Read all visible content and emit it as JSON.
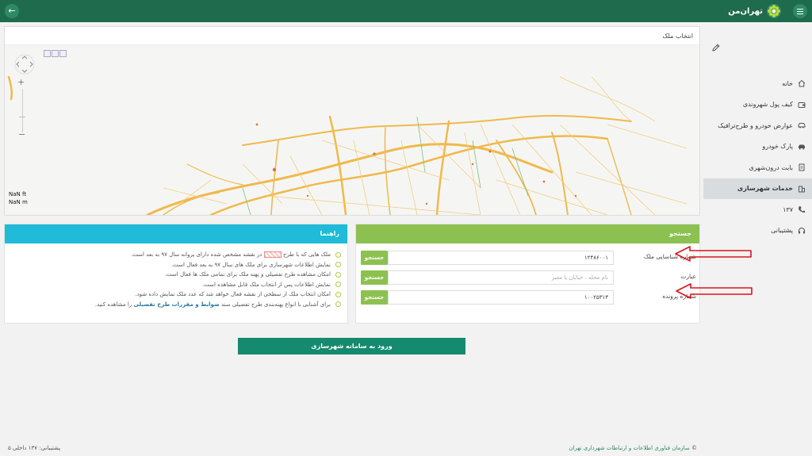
{
  "header": {
    "brand": "تهران‌من"
  },
  "sidebar": {
    "items": [
      {
        "label": "خانه",
        "icon": "home-icon"
      },
      {
        "label": "کیف پول شهروندی",
        "icon": "wallet-icon"
      },
      {
        "label": "عوارض خودرو و طرح‌ترافیک",
        "icon": "car-icon"
      },
      {
        "label": "پارک خودرو",
        "icon": "parking-icon"
      },
      {
        "label": "بابت درون‌شهری",
        "icon": "receipt-icon"
      },
      {
        "label": "خدمات شهرسازی",
        "icon": "building-icon",
        "active": true
      },
      {
        "label": "۱۳۷",
        "icon": "phone-icon"
      },
      {
        "label": "پشتیبانی",
        "icon": "headset-icon"
      }
    ]
  },
  "map": {
    "title": "انتخاب ملک",
    "scale_ft": "NaN ft",
    "scale_m": "NaN m"
  },
  "guide": {
    "title": "راهنما",
    "items": [
      {
        "pre": "ملک هایی که با طرح",
        "post": "در نقشه مشخص شده دارای پروانه سال ۹۷ به بعد است."
      },
      {
        "text": "نمایش اطلاعات شهرسازی برای ملک های سال ۹۷ به بعد فعال است."
      },
      {
        "text": "امکان مشاهده طرح تفصیلی و پهنه ملک برای تمامی ملک ها فعال است."
      },
      {
        "text": "نمایش اطلاعات پس از انتخاب ملک قابل مشاهده است."
      },
      {
        "text": "امکان انتخاب ملک از سطحی از نقشه فعال خواهد شد که عدد ملک نمایش داده شود."
      },
      {
        "pre": "برای آشنایی با انواع پهنه‌بندی طرح تفصیلی سند",
        "link": "ضوابط و مقررات طرح تفصیلی",
        "post": "را مشاهده کنید."
      }
    ]
  },
  "search": {
    "title": "جستجو",
    "button_label": "جستجو",
    "rows": [
      {
        "label": "شماره شناسایی ملک",
        "value": "۱۲۴۸۶۰۰۱",
        "placeholder": ""
      },
      {
        "label": "عبارت",
        "value": "",
        "placeholder": "نام محله ، خیابان یا معبر"
      },
      {
        "label": "شماره پرونده",
        "value": "۱۰۰۲۵۳۱۳",
        "placeholder": ""
      }
    ]
  },
  "actions": {
    "enter_label": "ورود به سامانه شهرسازی"
  },
  "footer": {
    "support": "پشتیبانی: ۱۳۷ داخلی ۵",
    "copyright_symbol": "©",
    "copyright": "سازمان فناوری اطلاعات و ارتباطات شهرداری تهران"
  },
  "colors": {
    "header": "#1e6b4e",
    "guide": "#1fbbd8",
    "search": "#8cc152",
    "enter": "#148a6e",
    "arrow": "#d9141a"
  }
}
